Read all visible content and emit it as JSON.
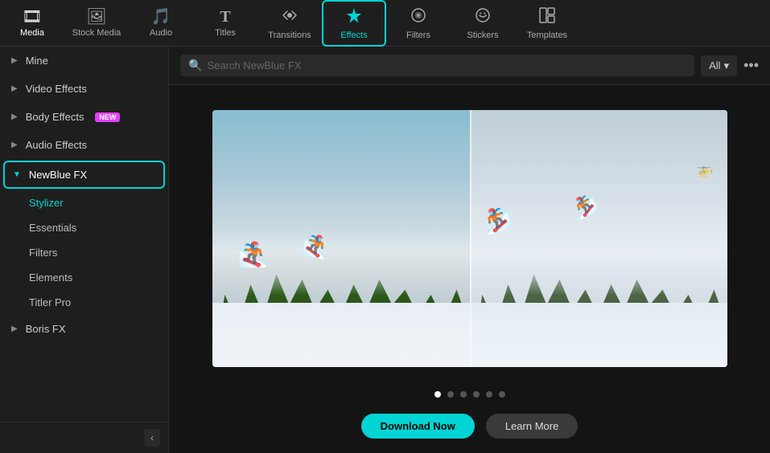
{
  "toolbar": {
    "items": [
      {
        "id": "media",
        "label": "Media",
        "icon": "🎞"
      },
      {
        "id": "stock-media",
        "label": "Stock Media",
        "icon": "🖼"
      },
      {
        "id": "audio",
        "label": "Audio",
        "icon": "🎵"
      },
      {
        "id": "titles",
        "label": "Titles",
        "icon": "T"
      },
      {
        "id": "transitions",
        "label": "Transitions",
        "icon": "↔"
      },
      {
        "id": "effects",
        "label": "Effects",
        "icon": "✨",
        "active": true
      },
      {
        "id": "filters",
        "label": "Filters",
        "icon": "◈"
      },
      {
        "id": "stickers",
        "label": "Stickers",
        "icon": "⊙"
      },
      {
        "id": "templates",
        "label": "Templates",
        "icon": "⊞"
      }
    ]
  },
  "sidebar": {
    "sections": [
      {
        "id": "mine",
        "label": "Mine",
        "expanded": false
      },
      {
        "id": "video-effects",
        "label": "Video Effects",
        "expanded": false
      },
      {
        "id": "body-effects",
        "label": "Body Effects",
        "expanded": false,
        "badge": "NEW"
      },
      {
        "id": "audio-effects",
        "label": "Audio Effects",
        "expanded": false
      },
      {
        "id": "newblue-fx",
        "label": "NewBlue FX",
        "expanded": true,
        "active": true,
        "subitems": [
          {
            "id": "stylizer",
            "label": "Stylizer",
            "active": true
          },
          {
            "id": "essentials",
            "label": "Essentials"
          },
          {
            "id": "filters",
            "label": "Filters"
          },
          {
            "id": "elements",
            "label": "Elements"
          },
          {
            "id": "titler-pro",
            "label": "Titler Pro"
          }
        ]
      },
      {
        "id": "boris-fx",
        "label": "Boris FX",
        "expanded": false
      }
    ],
    "collapse_icon": "‹"
  },
  "search": {
    "placeholder": "Search NewBlue FX",
    "filter_label": "All",
    "more_icon": "···"
  },
  "pagination": {
    "dots": [
      {
        "id": 1,
        "active": true
      },
      {
        "id": 2,
        "active": false
      },
      {
        "id": 3,
        "active": false
      },
      {
        "id": 4,
        "active": false
      },
      {
        "id": 5,
        "active": false
      },
      {
        "id": 6,
        "active": false
      }
    ]
  },
  "actions": {
    "download_label": "Download Now",
    "learn_label": "Learn More"
  }
}
